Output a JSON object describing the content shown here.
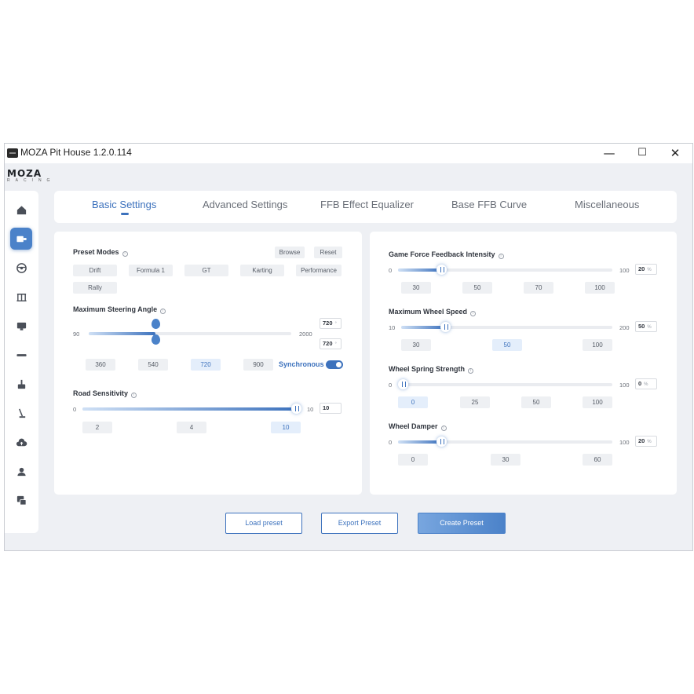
{
  "window": {
    "title": "MOZA Pit House 1.2.0.114",
    "controls": {
      "minimize": "—",
      "maximize": "☐",
      "close": "✕"
    }
  },
  "brand": {
    "logo": "MOZA",
    "sub": "RACING"
  },
  "sidebar": {
    "items": [
      {
        "icon": "home-icon",
        "active": false
      },
      {
        "icon": "wheelbase-icon",
        "active": true
      },
      {
        "icon": "steering-wheel-icon",
        "active": false
      },
      {
        "icon": "pedals-icon",
        "active": false
      },
      {
        "icon": "dashboard-icon",
        "active": false
      },
      {
        "icon": "shifter-icon",
        "active": false
      },
      {
        "icon": "handbrake-icon",
        "active": false
      },
      {
        "icon": "gear-lever-icon",
        "active": false
      },
      {
        "icon": "cloud-icon",
        "active": false
      },
      {
        "icon": "user-icon",
        "active": false
      },
      {
        "icon": "support-icon",
        "active": false
      }
    ]
  },
  "tabs": [
    {
      "label": "Basic Settings",
      "active": true
    },
    {
      "label": "Advanced Settings",
      "active": false
    },
    {
      "label": "FFB Effect Equalizer",
      "active": false
    },
    {
      "label": "Base FFB Curve",
      "active": false
    },
    {
      "label": "Miscellaneous",
      "active": false
    }
  ],
  "left": {
    "preset_modes": {
      "label": "Preset Modes",
      "browse": "Browse",
      "reset": "Reset",
      "options": [
        "Drift",
        "Formula 1",
        "GT",
        "Karting",
        "Performance",
        "Rally"
      ]
    },
    "steering_angle": {
      "label": "Maximum Steering Angle",
      "min": "90",
      "max": "2000",
      "value_top": "720",
      "value_bottom": "720",
      "unit": "°",
      "fraction": 0.33,
      "presets": [
        "360",
        "540",
        "720",
        "900"
      ],
      "selected_preset": "720",
      "sync_label": "Synchronous",
      "sync_on": true
    },
    "road_sensitivity": {
      "label": "Road Sensitivity",
      "min": "0",
      "max": "10",
      "value": "10",
      "fraction": 1.0,
      "presets": [
        "2",
        "4",
        "10"
      ],
      "selected_preset": "10"
    }
  },
  "right": {
    "ffb_intensity": {
      "label": "Game Force Feedback Intensity",
      "min": "0",
      "max": "100",
      "value": "20",
      "unit": "%",
      "fraction": 0.2,
      "presets": [
        "30",
        "50",
        "70",
        "100"
      ],
      "selected_preset": ""
    },
    "wheel_speed": {
      "label": "Maximum Wheel Speed",
      "min": "10",
      "max": "200",
      "value": "50",
      "unit": "%",
      "fraction": 0.21,
      "presets": [
        "30",
        "50",
        "100"
      ],
      "selected_preset": "50"
    },
    "spring_strength": {
      "label": "Wheel Spring Strength",
      "min": "0",
      "max": "100",
      "value": "0",
      "unit": "%",
      "fraction": 0.0,
      "presets": [
        "0",
        "25",
        "50",
        "100"
      ],
      "selected_preset": "0"
    },
    "damper": {
      "label": "Wheel Damper",
      "min": "0",
      "max": "100",
      "value": "20",
      "unit": "%",
      "fraction": 0.2,
      "presets": [
        "0",
        "30",
        "60"
      ],
      "selected_preset": ""
    }
  },
  "footer": {
    "load": "Load preset",
    "export": "Export Preset",
    "create": "Create Preset"
  },
  "colors": {
    "accent": "#3d72bd",
    "accent_light": "#78a6df",
    "background": "#eef0f4"
  }
}
